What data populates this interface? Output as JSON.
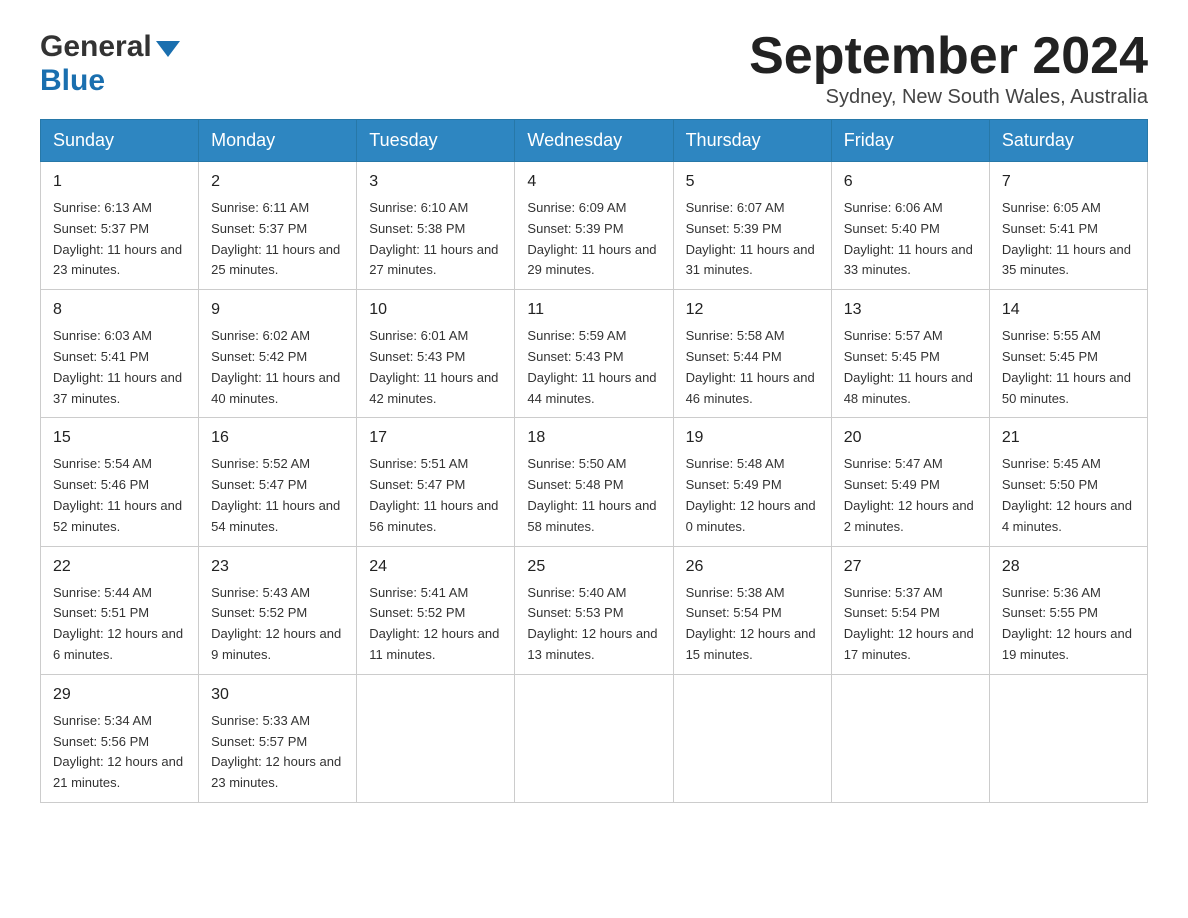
{
  "header": {
    "logo_line1": "General",
    "logo_line2": "Blue",
    "month_year": "September 2024",
    "location": "Sydney, New South Wales, Australia"
  },
  "days_of_week": [
    "Sunday",
    "Monday",
    "Tuesday",
    "Wednesday",
    "Thursday",
    "Friday",
    "Saturday"
  ],
  "weeks": [
    [
      {
        "day": "1",
        "sunrise": "6:13 AM",
        "sunset": "5:37 PM",
        "daylight": "11 hours and 23 minutes."
      },
      {
        "day": "2",
        "sunrise": "6:11 AM",
        "sunset": "5:37 PM",
        "daylight": "11 hours and 25 minutes."
      },
      {
        "day": "3",
        "sunrise": "6:10 AM",
        "sunset": "5:38 PM",
        "daylight": "11 hours and 27 minutes."
      },
      {
        "day": "4",
        "sunrise": "6:09 AM",
        "sunset": "5:39 PM",
        "daylight": "11 hours and 29 minutes."
      },
      {
        "day": "5",
        "sunrise": "6:07 AM",
        "sunset": "5:39 PM",
        "daylight": "11 hours and 31 minutes."
      },
      {
        "day": "6",
        "sunrise": "6:06 AM",
        "sunset": "5:40 PM",
        "daylight": "11 hours and 33 minutes."
      },
      {
        "day": "7",
        "sunrise": "6:05 AM",
        "sunset": "5:41 PM",
        "daylight": "11 hours and 35 minutes."
      }
    ],
    [
      {
        "day": "8",
        "sunrise": "6:03 AM",
        "sunset": "5:41 PM",
        "daylight": "11 hours and 37 minutes."
      },
      {
        "day": "9",
        "sunrise": "6:02 AM",
        "sunset": "5:42 PM",
        "daylight": "11 hours and 40 minutes."
      },
      {
        "day": "10",
        "sunrise": "6:01 AM",
        "sunset": "5:43 PM",
        "daylight": "11 hours and 42 minutes."
      },
      {
        "day": "11",
        "sunrise": "5:59 AM",
        "sunset": "5:43 PM",
        "daylight": "11 hours and 44 minutes."
      },
      {
        "day": "12",
        "sunrise": "5:58 AM",
        "sunset": "5:44 PM",
        "daylight": "11 hours and 46 minutes."
      },
      {
        "day": "13",
        "sunrise": "5:57 AM",
        "sunset": "5:45 PM",
        "daylight": "11 hours and 48 minutes."
      },
      {
        "day": "14",
        "sunrise": "5:55 AM",
        "sunset": "5:45 PM",
        "daylight": "11 hours and 50 minutes."
      }
    ],
    [
      {
        "day": "15",
        "sunrise": "5:54 AM",
        "sunset": "5:46 PM",
        "daylight": "11 hours and 52 minutes."
      },
      {
        "day": "16",
        "sunrise": "5:52 AM",
        "sunset": "5:47 PM",
        "daylight": "11 hours and 54 minutes."
      },
      {
        "day": "17",
        "sunrise": "5:51 AM",
        "sunset": "5:47 PM",
        "daylight": "11 hours and 56 minutes."
      },
      {
        "day": "18",
        "sunrise": "5:50 AM",
        "sunset": "5:48 PM",
        "daylight": "11 hours and 58 minutes."
      },
      {
        "day": "19",
        "sunrise": "5:48 AM",
        "sunset": "5:49 PM",
        "daylight": "12 hours and 0 minutes."
      },
      {
        "day": "20",
        "sunrise": "5:47 AM",
        "sunset": "5:49 PM",
        "daylight": "12 hours and 2 minutes."
      },
      {
        "day": "21",
        "sunrise": "5:45 AM",
        "sunset": "5:50 PM",
        "daylight": "12 hours and 4 minutes."
      }
    ],
    [
      {
        "day": "22",
        "sunrise": "5:44 AM",
        "sunset": "5:51 PM",
        "daylight": "12 hours and 6 minutes."
      },
      {
        "day": "23",
        "sunrise": "5:43 AM",
        "sunset": "5:52 PM",
        "daylight": "12 hours and 9 minutes."
      },
      {
        "day": "24",
        "sunrise": "5:41 AM",
        "sunset": "5:52 PM",
        "daylight": "12 hours and 11 minutes."
      },
      {
        "day": "25",
        "sunrise": "5:40 AM",
        "sunset": "5:53 PM",
        "daylight": "12 hours and 13 minutes."
      },
      {
        "day": "26",
        "sunrise": "5:38 AM",
        "sunset": "5:54 PM",
        "daylight": "12 hours and 15 minutes."
      },
      {
        "day": "27",
        "sunrise": "5:37 AM",
        "sunset": "5:54 PM",
        "daylight": "12 hours and 17 minutes."
      },
      {
        "day": "28",
        "sunrise": "5:36 AM",
        "sunset": "5:55 PM",
        "daylight": "12 hours and 19 minutes."
      }
    ],
    [
      {
        "day": "29",
        "sunrise": "5:34 AM",
        "sunset": "5:56 PM",
        "daylight": "12 hours and 21 minutes."
      },
      {
        "day": "30",
        "sunrise": "5:33 AM",
        "sunset": "5:57 PM",
        "daylight": "12 hours and 23 minutes."
      },
      null,
      null,
      null,
      null,
      null
    ]
  ],
  "labels": {
    "sunrise_prefix": "Sunrise: ",
    "sunset_prefix": "Sunset: ",
    "daylight_prefix": "Daylight: "
  }
}
